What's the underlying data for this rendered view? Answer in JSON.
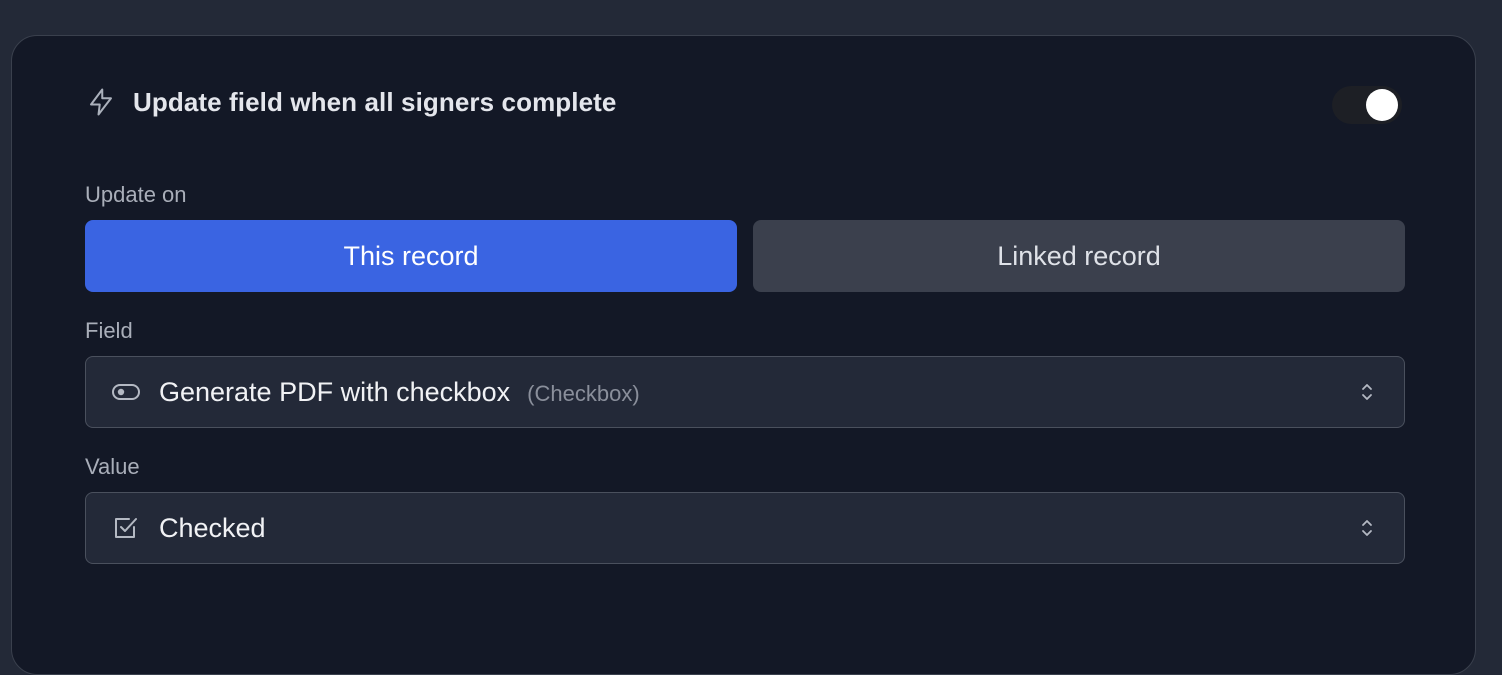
{
  "header": {
    "title": "Update field when all signers complete",
    "icon": "lightning-icon",
    "toggle_on": true
  },
  "update_on": {
    "label": "Update on",
    "options": [
      "This record",
      "Linked record"
    ],
    "selected": "This record"
  },
  "field": {
    "label": "Field",
    "value": "Generate PDF with checkbox",
    "type": "(Checkbox)",
    "icon": "toggle-field-icon"
  },
  "value": {
    "label": "Value",
    "value": "Checked",
    "icon": "checkbox-checked-icon"
  },
  "colors": {
    "accent": "#3a64e2",
    "card_bg": "#131826",
    "page_bg": "#232937"
  }
}
